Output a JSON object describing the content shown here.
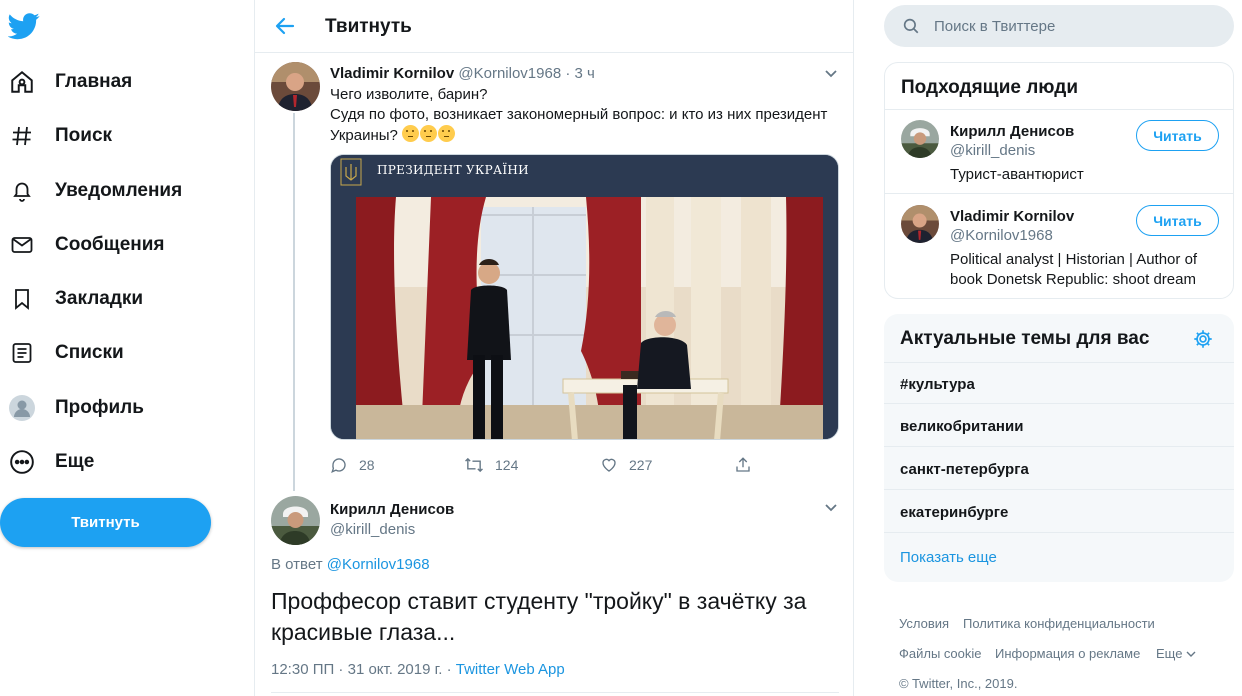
{
  "colors": {
    "accent": "#1da1f2",
    "link": "#1b95e0",
    "text": "#14171a",
    "secondary": "#657786",
    "border": "#e6ecf0"
  },
  "nav": {
    "items": [
      {
        "icon": "home-icon",
        "label": "Главная"
      },
      {
        "icon": "hashtag-icon",
        "label": "Поиск"
      },
      {
        "icon": "bell-icon",
        "label": "Уведомления"
      },
      {
        "icon": "envelope-icon",
        "label": "Сообщения"
      },
      {
        "icon": "bookmark-icon",
        "label": "Закладки"
      },
      {
        "icon": "list-icon",
        "label": "Списки"
      },
      {
        "icon": "profile-avatar-icon",
        "label": "Профиль"
      },
      {
        "icon": "more-icon",
        "label": "Еще"
      }
    ],
    "tweet_button": "Твитнуть"
  },
  "main": {
    "title": "Твитнуть",
    "tweet": {
      "name": "Vladimir Kornilov",
      "handle": "@Kornilov1968",
      "dot": "·",
      "time": "3 ч",
      "line1": "Чего изволите, барин?",
      "line2": "Судя по фото, возникает закономерный вопрос: и кто из них президент Украины?",
      "media_caption": "ПРЕЗИДЕНТ УКРАЇНИ",
      "replies": "28",
      "retweets": "124",
      "likes": "227"
    },
    "reply": {
      "name": "Кирилл Денисов",
      "handle": "@kirill_denis",
      "reply_prefix": "В ответ",
      "reply_to": "@Kornilov1968",
      "text": "Проффесор ставит студенту \"тройку\" в зачётку за красивые глаза...",
      "timestamp": "12:30 ПП · 31 окт. 2019 г. ·",
      "source": "Twitter Web App"
    }
  },
  "search": {
    "placeholder": "Поиск в Твиттере"
  },
  "who_to_follow": {
    "title": "Подходящие люди",
    "people": [
      {
        "name": "Кирилл Денисов",
        "handle": "@kirill_denis",
        "bio": "Турист-авантюрист",
        "button": "Читать"
      },
      {
        "name": "Vladimir Kornilov",
        "handle": "@Kornilov1968",
        "bio": "Political analyst | Historian | Author of book Donetsk Republic: shoot dream",
        "button": "Читать"
      }
    ]
  },
  "trends": {
    "title": "Актуальные темы для вас",
    "items": [
      "#культура",
      "великобритании",
      "санкт-петербурга",
      "екатеринбурге"
    ],
    "show_more": "Показать еще"
  },
  "footer": {
    "terms": "Условия",
    "privacy": "Политика конфиденциальности",
    "cookies": "Файлы cookie",
    "ads": "Информация о рекламе",
    "more": "Еще",
    "copyright": "© Twitter, Inc., 2019."
  }
}
